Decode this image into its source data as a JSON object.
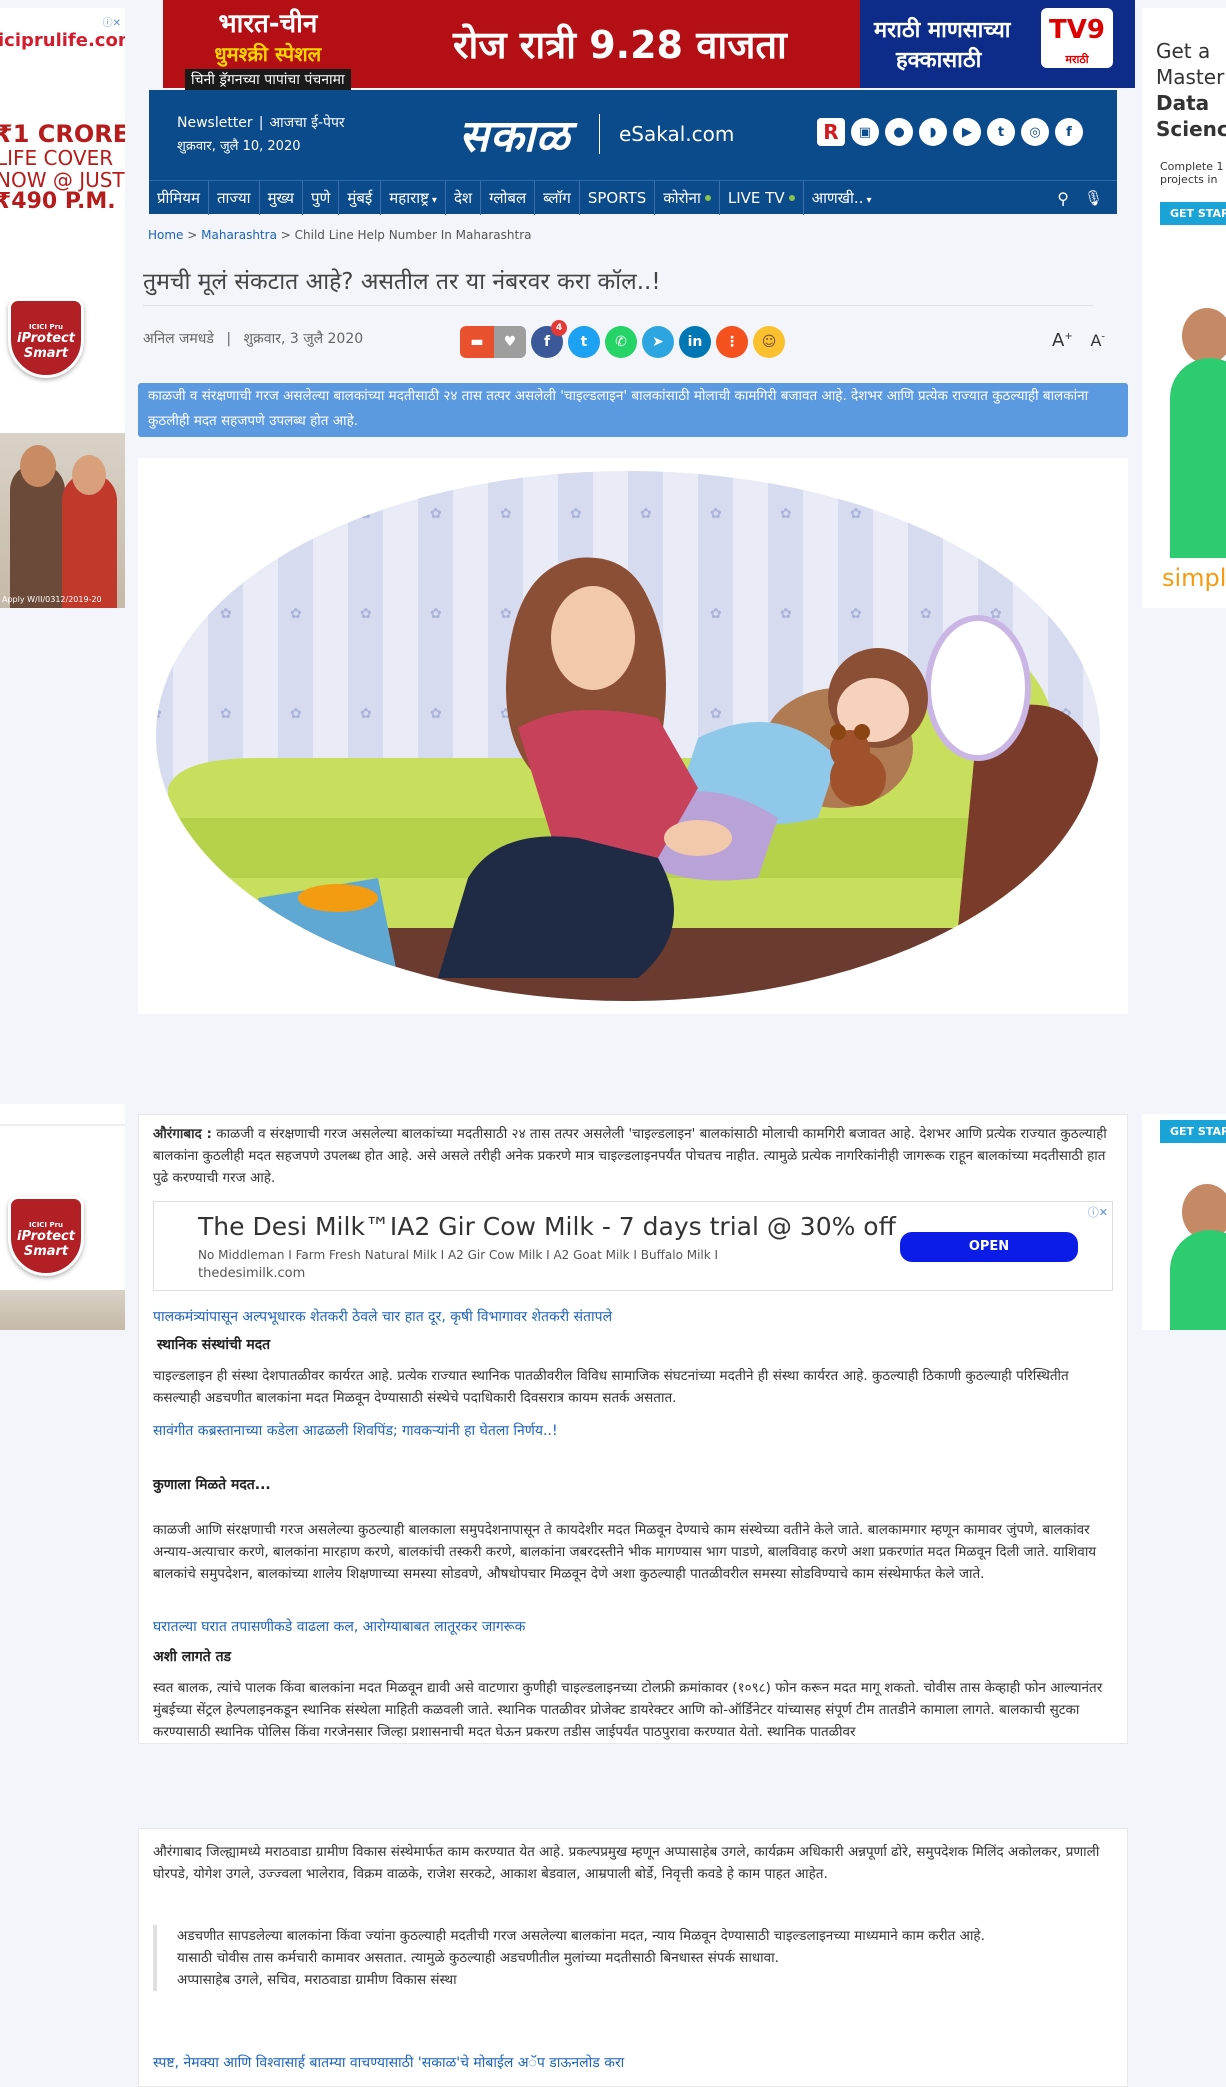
{
  "left_ad": {
    "url": "iciprulife.com",
    "crore_line1": "₹1 CRORE",
    "crore_line2": "LIFE COVER",
    "crore_line3": "NOW @ JUST",
    "crore_line4": "₹490 P.M.",
    "shield_top": "ICICI Pru",
    "shield_name": "iProtect Smart",
    "fine_print": "Apply W/II/0312/2019-20"
  },
  "right_ad": {
    "line1": "Get a",
    "line2": "Master",
    "line3": "Data",
    "line4": "Scienc",
    "small": "Complete 1",
    "small2": "projects in",
    "button": "GET STAR",
    "brand": "simpli"
  },
  "top_banner": {
    "left_line1": "भारत-चीन",
    "left_line2": "धुमश्क्री स्पेशल",
    "left_line3": "चिनी ड्रॅगनच्या पापांचा पंचनामा",
    "middle": "रोज रात्री 9.28 वाजता",
    "right_line1": "मराठी माणसाच्या",
    "right_line2": "हक्कासाठी",
    "logo": "TV9",
    "logo_sub": "मराठी"
  },
  "header": {
    "newsletter": "Newsletter",
    "epaper": "आजचा ई-पेपर",
    "date": "शुक्रवार, जुलै 10, 2020",
    "logo": "सकाळ",
    "esakal": "eSakal.com",
    "social_icons": [
      "R",
      "android-icon",
      "apple-icon",
      "rss-icon",
      "youtube-icon",
      "twitter-icon",
      "instagram-icon",
      "facebook-icon"
    ]
  },
  "nav": {
    "items": [
      "प्रीमियम",
      "ताज्या",
      "मुख्य",
      "पुणे",
      "मुंबई",
      "महाराष्ट्र",
      "देश",
      "ग्लोबल",
      "ब्लॉग",
      "SPORTS",
      "कोरोना",
      "LIVE TV",
      "आणखी.."
    ]
  },
  "breadcrumb": {
    "home": "Home",
    "section": "Maharashtra",
    "current": "Child Line Help Number In Maharashtra"
  },
  "article": {
    "title": "तुमची मूलं संकटात आहे? असतील तर या नंबरवर करा कॉल..!",
    "author": "अनिल जमधडे",
    "date": "शुक्रवार, 3 जुलै 2020",
    "share_count": "4",
    "summary": "काळजी व संरक्षणाची गरज असलेल्या बालकांच्या मदतीसाठी २४ तास तत्पर असलेली 'चाइल्डलाइन' बालकांसाठी मोलाची कामगिरी बजावत आहे. देशभर आणि प्रत्येक राज्यात कुठल्याही बालकांना कुठलीही मदत सहजपणे उपलब्ध होत आहे.",
    "lead_place": "औरंगाबाद :",
    "lead": " काळजी व संरक्षणाची गरज असलेल्या बालकांच्या मदतीसाठी २४ तास तत्पर असलेली 'चाइल्डलाइन' बालकांसाठी मोलाची कामगिरी बजावत आहे. देशभर आणि प्रत्येक राज्यात कुठल्याही बालकांना कुठलीही मदत सहजपणे उपलब्ध होत आहे. असे असले तरीही अनेक प्रकरणे मात्र चाइल्डलाइनपर्यंत पोचतच नाहीत. त्यामुळे प्रत्येक नागरिकांनीही जागरूक राहून बालकांच्या मदतीसाठी हात पुढे करण्याची गरज आहे.",
    "related1": "पालकमंत्र्यांपासून अल्पभूधारक शेतकरी ठेवले चार हात दूर, कृषी विभागावर शेतकरी संतापले",
    "heading1": "स्थानिक संस्थांची मदत",
    "para2": "चाइल्डलाइन ही संस्था देशपातळीवर कार्यरत आहे. प्रत्येक राज्यात स्थानिक पातळीवरील विविध सामाजिक संघटनांच्या मदतीने ही संस्था कार्यरत आहे. कुठल्याही ठिकाणी कुठल्याही परिस्थितीत कसल्याही अडचणीत बालकांना मदत मिळवून देण्यासाठी संस्थेचे पदाधिकारी दिवसरात्र कायम सतर्क असतात.",
    "related2": "सावंगीत कब्रस्तानाच्या कडेला आढळली शिवपिंड; गावकऱ्यांनी हा घेतला निर्णय..!",
    "heading2": "कुणाला मिळते मदत...",
    "para3": "काळजी आणि संरक्षणाची गरज असलेल्या कुठल्याही बालकाला समुपदेशनापासून ते कायदेशीर मदत मिळवून देण्याचे काम संस्थेच्या वतीने केले जाते. बालकामगार म्हणून कामावर जुंपणे, बालकांवर अन्याय-अत्याचार करणे, बालकांना मारहाण करणे, बालकांची तस्करी करणे, बालकांना जबरदस्तीने भीक मागण्यास भाग पाडणे, बालविवाह करणे अशा प्रकरणांत मदत मिळवून दिली जाते. याशिवाय बालकांचे समुपदेशन, बालकांच्या शालेय शिक्षणाच्या समस्या सोडवणे, औषधोपचार मिळवून देणे अशा कुठल्याही पातळीवरील समस्या सोडविण्याचे काम संस्थेमार्फत केले जाते.",
    "related3": "घरातल्या घरात तपासणीकडे वाढला कल, आरोग्याबाबत लातूरकर जागरूक",
    "heading3": "अशी लागते तड",
    "para4": "स्वत बालक, त्यांचे पालक किंवा बालकांना मदत मिळवून द्यावी असे वाटणारा कुणीही चाइल्डलाइनच्या टोलफ्री क्रमांकावर (१०९८) फोन करून मदत मागू शकतो. चोवीस तास केव्हाही फोन आल्यानंतर मुंबईच्या सेंट्रल हेल्पलाइनकडून स्थानिक संस्थेला माहिती कळवली जाते. स्थानिक पातळीवर प्रोजेक्ट डायरेक्टर आणि को-ऑर्डिनेटर यांच्यासह संपूर्ण टीम तातडीने कामाला लागते. बालकाची सुटका करण्यासाठी स्थानिक पोलिस किंवा गरजेनसार जिल्हा प्रशासनाची मदत घेऊन प्रकरण तडीस जाईपर्यंत पाठपुरावा करण्यात येतो. स्थानिक पातळीवर",
    "para5": "औरंगाबाद जिल्ह्यामध्ये मराठवाडा ग्रामीण विकास संस्थेमार्फत काम करण्यात येत आहे. प्रकल्पप्रमुख म्हणून अप्पासाहेब उगले, कार्यक्रम अधिकारी अन्नपूर्णा ढोरे, समुपदेशक मिलिंद अकोलकर, प्रणाली घोरपडे, योगेश उगले, उज्ज्वला भालेराव, विक्रम वाळके, राजेश सरकटे, आकाश बेडवाल, आम्रपाली बोर्डे, निवृत्ती कवडे हे काम पाहत आहेत.",
    "quote_line1": "अडचणीत सापडलेल्या बालकांना किंवा ज्यांना कुठल्याही मदतीची गरज असलेल्या बालकांना मदत, न्याय मिळवून देण्यासाठी चाइल्डलाइनच्या माध्यमाने काम करीत आहे.",
    "quote_line2": "यासाठी चोवीस तास कर्मचारी कामावर असतात. त्यामुळे कुठल्याही अडचणीतील मुलांच्या मदतीसाठी बिनधास्त संपर्क साधावा.",
    "quote_author": "अप्पासाहेब उगले, सचिव, मराठवाडा ग्रामीण विकास संस्था",
    "app_link": "स्पष्ट, नेमक्या आणि विश्वासार्ह बातम्या वाचण्यासाठी 'सकाळ'चे मोबाईल अॅप डाऊनलोड करा"
  },
  "inline_ad": {
    "title": "The Desi Milk™IA2 Gir Cow Milk - 7 days trial @ 30% off",
    "desc": "No Middleman I Farm Fresh Natural Milk I A2 Gir Cow Milk I A2 Goat Milk I Buffalo Milk I",
    "url": "thedesimilk.com",
    "button": "OPEN"
  },
  "colors": {
    "header_blue": "#0b4a8b",
    "summary_blue": "#5b99e0",
    "link_blue": "#1e63b5",
    "banner_red": "#b40f14"
  }
}
